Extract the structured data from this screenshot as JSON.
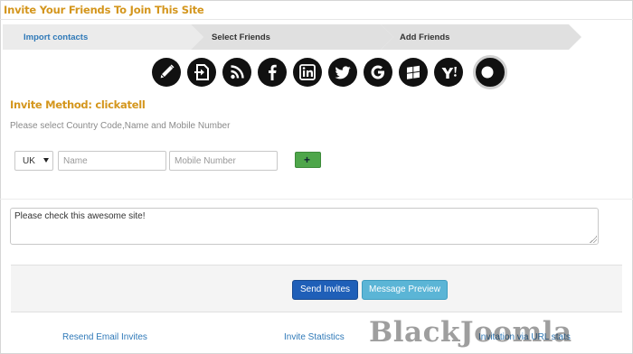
{
  "page": {
    "title": "Invite Your Friends To Join This Site"
  },
  "steps": [
    {
      "label": "Import contacts",
      "active": true
    },
    {
      "label": "Select Friends",
      "active": false
    },
    {
      "label": "Add Friends",
      "active": false
    }
  ],
  "methods": [
    {
      "name": "pencil-icon",
      "glyph": "pencil"
    },
    {
      "name": "import-icon",
      "glyph": "import"
    },
    {
      "name": "rss-icon",
      "glyph": "rss"
    },
    {
      "name": "facebook-icon",
      "glyph": "facebook"
    },
    {
      "name": "linkedin-icon",
      "glyph": "linkedin"
    },
    {
      "name": "twitter-icon",
      "glyph": "twitter"
    },
    {
      "name": "google-icon",
      "glyph": "google"
    },
    {
      "name": "windows-live-icon",
      "glyph": "windows"
    },
    {
      "name": "yahoo-icon",
      "glyph": "yahoo"
    },
    {
      "name": "clickatell-icon",
      "glyph": "circle",
      "selected": true
    }
  ],
  "form": {
    "method_label": "Invite Method: clickatell",
    "hint": "Please select Country Code,Name and Mobile Number",
    "country_value": "UK",
    "name_placeholder": "Name",
    "mobile_placeholder": "Mobile Number",
    "add_label": "+",
    "message_value": "Please check this awesome site!"
  },
  "actions": {
    "send_label": "Send Invites",
    "preview_label": "Message Preview"
  },
  "footer": {
    "resend": "Resend Email Invites",
    "stats": "Invite Statistics",
    "url_stats": "Invitation via URL stats"
  },
  "watermark": "BlackJoomla",
  "colors": {
    "accent": "#d4961d",
    "step_active_bg": "#ebebeb",
    "step_inactive_bg": "#e0e0e0",
    "link": "#2f79b8",
    "send": "#1f5fb8",
    "preview": "#5bb5d6",
    "add": "#4ea64a"
  }
}
